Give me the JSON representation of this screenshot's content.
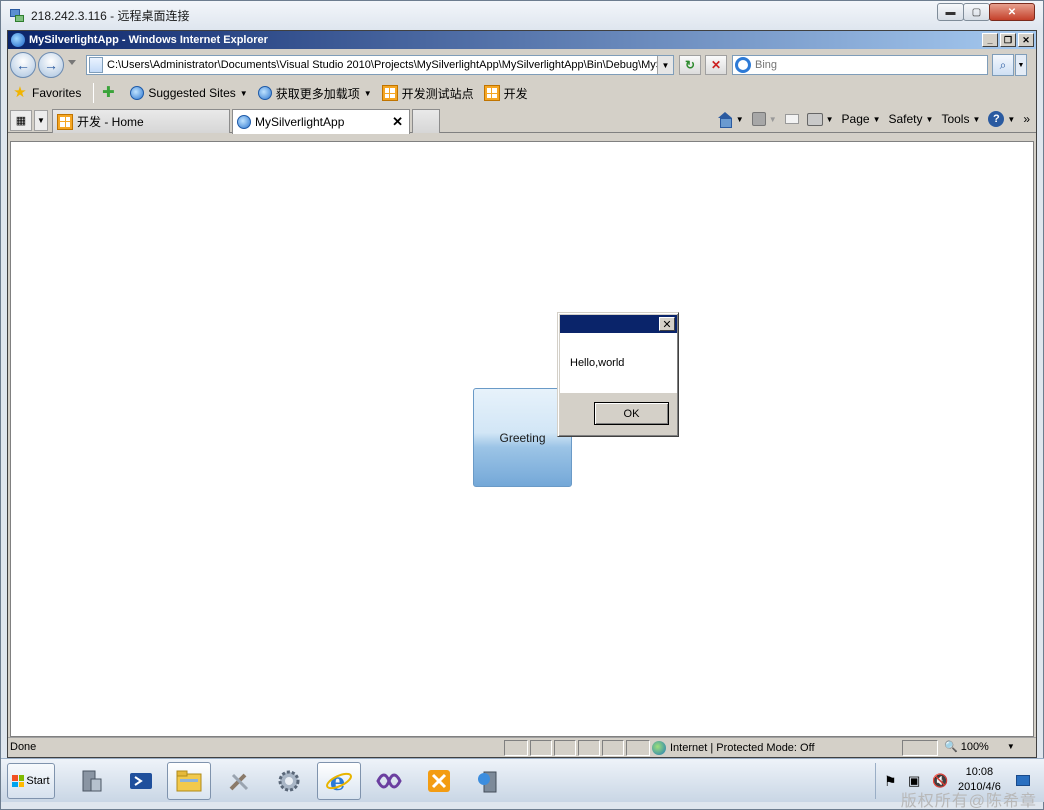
{
  "rdp": {
    "title": "218.242.3.116 - 远程桌面连接"
  },
  "ie": {
    "title": "MySilverlightApp - Windows Internet Explorer"
  },
  "address": {
    "value": "C:\\Users\\Administrator\\Documents\\Visual Studio 2010\\Projects\\MySilverlightApp\\MySilverlightApp\\Bin\\Debug\\MySi"
  },
  "search": {
    "placeholder": "Bing"
  },
  "favorites": {
    "favorites_label": "Favorites",
    "items": [
      "Suggested Sites",
      "获取更多加载项",
      "开发测试站点",
      "开发"
    ]
  },
  "tabs": [
    {
      "label": "开发 - Home"
    },
    {
      "label": "MySilverlightApp"
    }
  ],
  "toolbar": {
    "page": "Page",
    "safety": "Safety",
    "tools": "Tools",
    "help": "?"
  },
  "content": {
    "greeting_button": "Greeting"
  },
  "msgbox": {
    "message": "Hello,world",
    "ok": "OK"
  },
  "status": {
    "text": "Done",
    "zone": "Internet | Protected Mode: Off",
    "zoom": "100%"
  },
  "taskbar": {
    "start": "Start",
    "apps": [
      "server-manager-icon",
      "powershell-icon",
      "explorer-icon",
      "tools-icon",
      "settings-icon",
      "internet-explorer-icon",
      "visual-studio-icon",
      "utilities-icon",
      "iis-icon"
    ],
    "time": "10:08",
    "date": "2010/4/6"
  },
  "watermark": "版权所有@陈希章"
}
